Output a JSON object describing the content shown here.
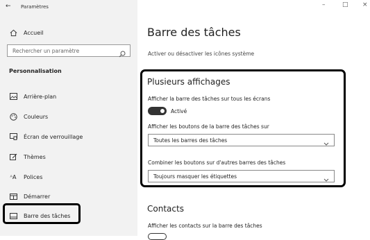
{
  "window": {
    "title": "Paramètres",
    "back_glyph": "←",
    "minimize_glyph": "–",
    "maximize_glyph": "□",
    "close_glyph": "×"
  },
  "sidebar": {
    "home_label": "Accueil",
    "search_placeholder": "Rechercher un paramètre",
    "section_label": "Personnalisation",
    "items": [
      {
        "label": "Arrière-plan",
        "icon": "image-icon"
      },
      {
        "label": "Couleurs",
        "icon": "palette-icon"
      },
      {
        "label": "Écran de verrouillage",
        "icon": "lock-screen-icon"
      },
      {
        "label": "Thèmes",
        "icon": "themes-icon"
      },
      {
        "label": "Polices",
        "icon": "fonts-icon"
      },
      {
        "label": "Démarrer",
        "icon": "start-icon"
      },
      {
        "label": "Barre des tâches",
        "icon": "taskbar-icon"
      }
    ]
  },
  "main": {
    "title": "Barre des tâches",
    "system_icons_link": "Activer ou désactiver les icônes système",
    "multi_display": {
      "heading": "Plusieurs affichages",
      "show_on_all_label": "Afficher la barre des tâches sur tous les écrans",
      "toggle_state": "Activé",
      "show_buttons_label": "Afficher les boutons de la barre des tâches sur",
      "show_buttons_value": "Toutes les barres des tâches",
      "combine_label": "Combiner les boutons sur d'autres barres des tâches",
      "combine_value": "Toujours masquer les étiquettes"
    },
    "contacts": {
      "heading": "Contacts",
      "show_contacts_label": "Afficher les contacts sur la barre des tâches"
    }
  }
}
